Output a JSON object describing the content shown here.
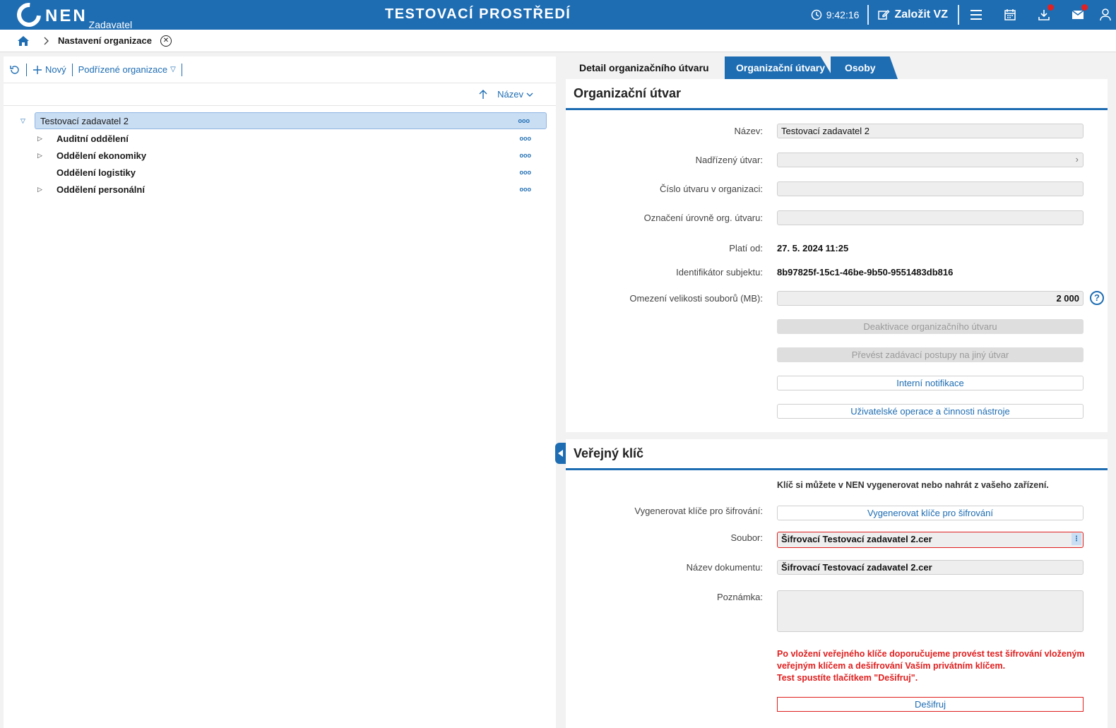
{
  "header": {
    "logo_text": "NEN",
    "logo_role": "Zadavatel",
    "environment": "TESTOVACÍ PROSTŘEDÍ",
    "clock": "9:42:16",
    "create_label": "Založit VZ",
    "accent_color": "#1e6db3"
  },
  "breadcrumb": {
    "current": "Nastavení organizace"
  },
  "left": {
    "new_label": "Nový",
    "sub_org_label": "Podřízené organizace",
    "sort_label": "Název",
    "tree": {
      "root": "Testovací zadavatel 2",
      "children": [
        "Auditní oddělení",
        "Oddělení ekonomiky",
        "Oddělení logistiky",
        "Oddělení personální"
      ]
    }
  },
  "tabs": [
    "Detail organizačního útvaru",
    "Organizační útvary",
    "Osoby"
  ],
  "org_unit": {
    "title": "Organizační útvar",
    "name_label": "Název",
    "name_value": "Testovací zadavatel 2",
    "parent_label": "Nadřízený útvar",
    "number_label": "Číslo útvaru v organizaci",
    "level_label": "Označení úrovně org. útvaru",
    "valid_label": "Platí od",
    "valid_value": "27. 5. 2024 11:25",
    "id_label": "Identifikátor subjektu",
    "id_value": "8b97825f-15c1-46be-9b50-9551483db816",
    "size_label": "Omezení velikosti souborů (MB)",
    "size_value": "2 000",
    "deactivate_label": "Deaktivace organizačního útvaru",
    "transfer_label": "Převést zadávací postupy na jiný útvar",
    "notify_label": "Interní notifikace",
    "ops_label": "Uživatelské operace a činnosti nástroje"
  },
  "public_key": {
    "title": "Veřejný klíč",
    "info": "Klíč si můžete v NEN vygenerovat nebo nahrát z vašeho zařízení.",
    "generate_label": "Vygenerovat klíče pro šifrování",
    "generate_button": "Vygenerovat klíče pro šifrování",
    "file_label": "Soubor",
    "file_value": "Šifrovací Testovací zadavatel 2.cer",
    "docname_label": "Název dokumentu",
    "docname_value": "Šifrovací Testovací zadavatel 2.cer",
    "note_label": "Poznámka",
    "warning_line1": "Po vložení veřejného klíče doporučujeme provést test šifrování vloženým",
    "warning_line2": "veřejným klíčem a dešifrování Vaším privátním klíčem.",
    "warning_line3": "Test spustíte tlačítkem \"Dešifruj\".",
    "decrypt_button": "Dešifruj",
    "warning_color": "#e01f1f"
  }
}
